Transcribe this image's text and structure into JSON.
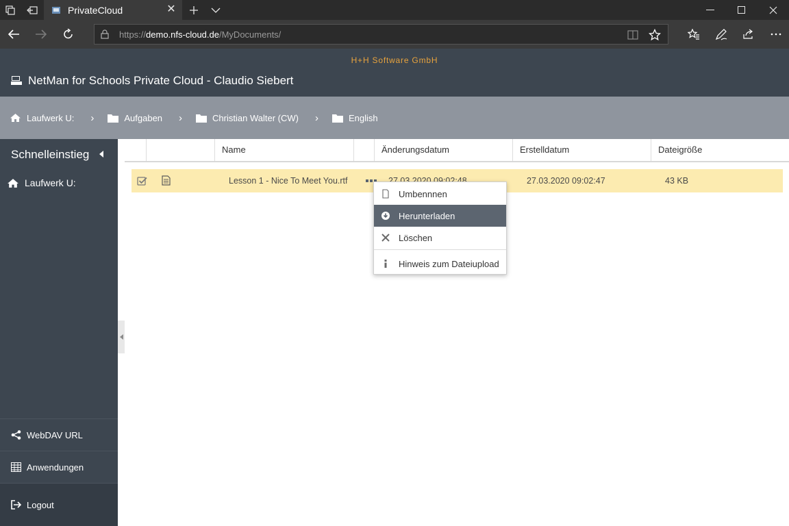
{
  "browser": {
    "tab_title": "PrivateCloud",
    "url_prefix": "https://",
    "url_host": "demo.nfs-cloud.de",
    "url_path": "/MyDocuments/"
  },
  "app": {
    "company": "H+H Software GmbH",
    "title": "NetMan for Schools Private Cloud - Claudio Siebert"
  },
  "breadcrumb": [
    {
      "label": "Laufwerk U:",
      "icon": "home-icon"
    },
    {
      "label": "Aufgaben",
      "icon": "folder-icon"
    },
    {
      "label": "Christian Walter (CW)",
      "icon": "folder-icon"
    },
    {
      "label": "English",
      "icon": "folder-icon"
    }
  ],
  "sidebar": {
    "heading": "Schnelleinstieg",
    "drive_label": "Laufwerk U:",
    "webdav_label": "WebDAV URL",
    "apps_label": "Anwendungen",
    "logout_label": "Logout"
  },
  "table": {
    "columns": [
      "Name",
      "Änderungsdatum",
      "Erstelldatum",
      "Dateigröße"
    ],
    "rows": [
      {
        "name": "Lesson 1 - Nice To Meet You.rtf",
        "modified": "27.03.2020 09:02:48",
        "created": "27.03.2020 09:02:47",
        "size": "43 KB",
        "selected": true
      }
    ]
  },
  "context_menu": {
    "items": [
      {
        "label": "Umbennnen",
        "icon": "page-icon"
      },
      {
        "label": "Herunterladen",
        "icon": "download-icon",
        "active": true
      },
      {
        "label": "Löschen",
        "icon": "delete-x-icon"
      },
      {
        "label": "Hinweis zum Dateiupload",
        "icon": "info-icon"
      }
    ]
  },
  "colors": {
    "header_bg": "#3d4650",
    "breadcrumb_bg": "#8f959e",
    "company_accent": "#e8a33d",
    "selected_row": "#fcebb0",
    "menu_active": "#5c6570"
  }
}
